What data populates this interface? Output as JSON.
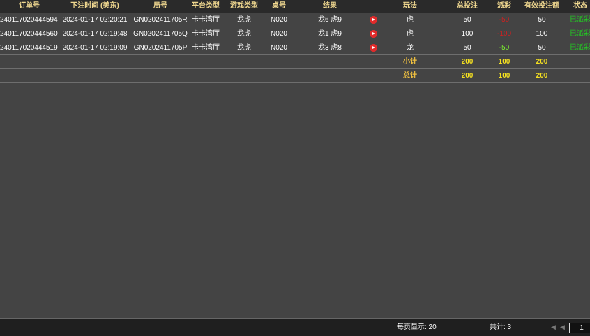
{
  "header": {
    "order_no": "订单号",
    "bet_time": "下注时间 (美东)",
    "round_no": "局号",
    "platform_type": "平台类型",
    "game_type": "游戏类型",
    "table_no": "桌号",
    "result": "结果",
    "play_type": "玩法",
    "total_bet": "总投注",
    "payout": "派彩",
    "valid_bet": "有效投注额",
    "status": "状态"
  },
  "rows": [
    {
      "order_no": "240117020444594",
      "bet_time": "2024-01-17 02:20:21",
      "round_no": "GN0202411705R",
      "platform": "卡卡湾厅",
      "game": "龙虎",
      "table": "N020",
      "result": "龙6 虎9",
      "play": "虎",
      "total": "50",
      "payout": "-50",
      "valid": "50",
      "status": "已派彩"
    },
    {
      "order_no": "240117020444560",
      "bet_time": "2024-01-17 02:19:48",
      "round_no": "GN0202411705Q",
      "platform": "卡卡湾厅",
      "game": "龙虎",
      "table": "N020",
      "result": "龙1 虎9",
      "play": "虎",
      "total": "100",
      "payout": "-100",
      "valid": "100",
      "status": "已派彩"
    },
    {
      "order_no": "240117020444519",
      "bet_time": "2024-01-17 02:19:09",
      "round_no": "GN0202411705P",
      "platform": "卡卡湾厅",
      "game": "龙虎",
      "table": "N020",
      "result": "龙3 虎8",
      "play": "龙",
      "total": "50",
      "payout": "-50",
      "valid": "50",
      "status": "已派彩"
    }
  ],
  "subtotal": {
    "label": "小计",
    "total": "200",
    "payout": "100",
    "valid": "200"
  },
  "grand_total": {
    "label": "总计",
    "total": "200",
    "payout": "100",
    "valid": "200"
  },
  "footer": {
    "per_page": "每页显示: 20",
    "total_count": "共计: 3",
    "prev_icon": "◀",
    "prev2_icon": "◀",
    "page_value": "1"
  },
  "colors": {
    "payout_red": "#d02020",
    "payout_green": "#7cf030",
    "status_green": "#22cc22",
    "summary_yellow": "#f5e020"
  }
}
